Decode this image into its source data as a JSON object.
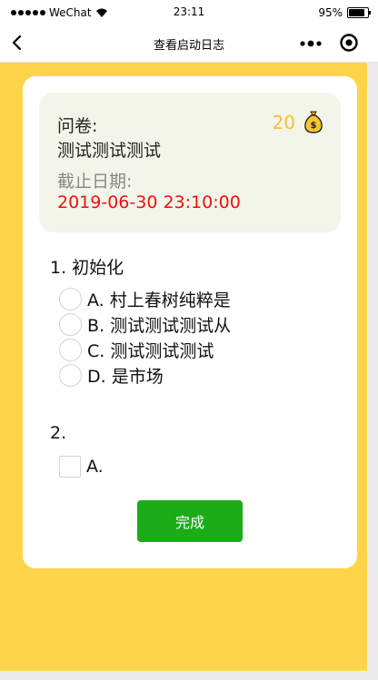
{
  "status_bar": {
    "carrier": "WeChat",
    "time": "23:11",
    "battery": "95%",
    "battery_level": 0.95
  },
  "nav": {
    "title": "查看启动日志",
    "back_icon": "chevron-left-icon",
    "more_icon": "more-dots-icon",
    "target_icon": "target-icon"
  },
  "info": {
    "survey_label": "问卷:",
    "survey_name": "测试测试测试",
    "points": "20",
    "coin_icon": "money-bag-icon",
    "deadline_label": "截止日期:",
    "deadline_value": "2019-06-30 23:10:00"
  },
  "questions": [
    {
      "title": "1. 初始化",
      "type": "radio",
      "options": [
        "A. 村上春树纯粹是",
        "B. 测试测试测试从",
        "C. 测试测试测试",
        "D. 是市场"
      ]
    },
    {
      "title": "2.",
      "type": "checkbox",
      "options": [
        "A."
      ]
    }
  ],
  "submit_label": "完成",
  "colors": {
    "background": "#fed54a",
    "points": "#f6c12f",
    "deadline": "#f01010",
    "button": "#1aad19"
  }
}
